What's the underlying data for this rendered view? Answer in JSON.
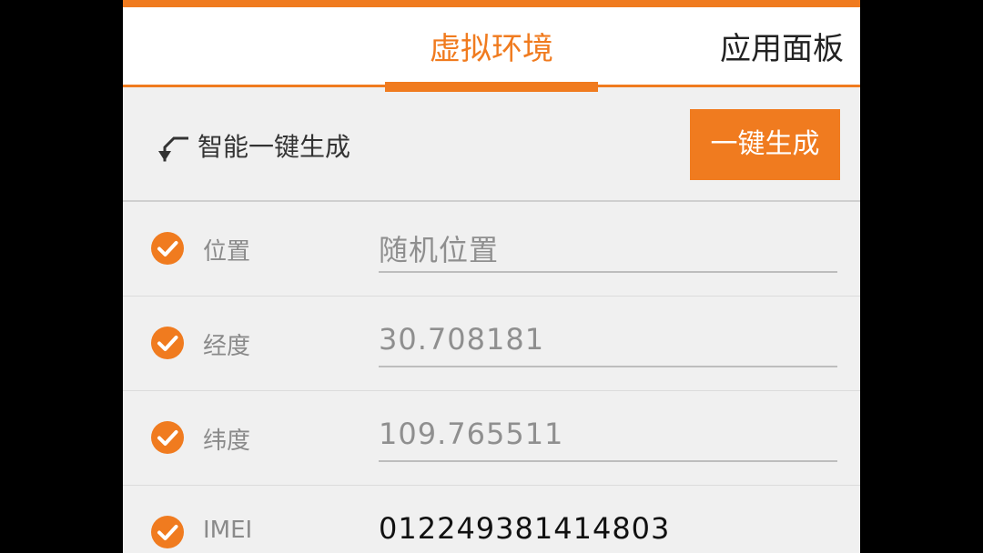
{
  "colors": {
    "accent": "#f07b1f",
    "background": "#f0f0f0",
    "text_dark": "#111111",
    "text_muted": "#8a8a8a"
  },
  "tabs": [
    {
      "label": "虚拟环境",
      "active": true
    },
    {
      "label": "应用面板",
      "active": false
    }
  ],
  "smart": {
    "label": "智能一键生成",
    "button_label": "一键生成",
    "icon": "arrow-down-icon"
  },
  "fields": [
    {
      "label": "位置",
      "value": "随机位置",
      "checked": true,
      "icon": "check-circle-icon"
    },
    {
      "label": "经度",
      "value": "30.708181",
      "checked": true,
      "icon": "check-circle-icon"
    },
    {
      "label": "纬度",
      "value": "109.765511",
      "checked": true,
      "icon": "check-circle-icon"
    },
    {
      "label": "IMEI",
      "value": "012249381414803",
      "checked": true,
      "icon": "check-circle-icon"
    }
  ]
}
